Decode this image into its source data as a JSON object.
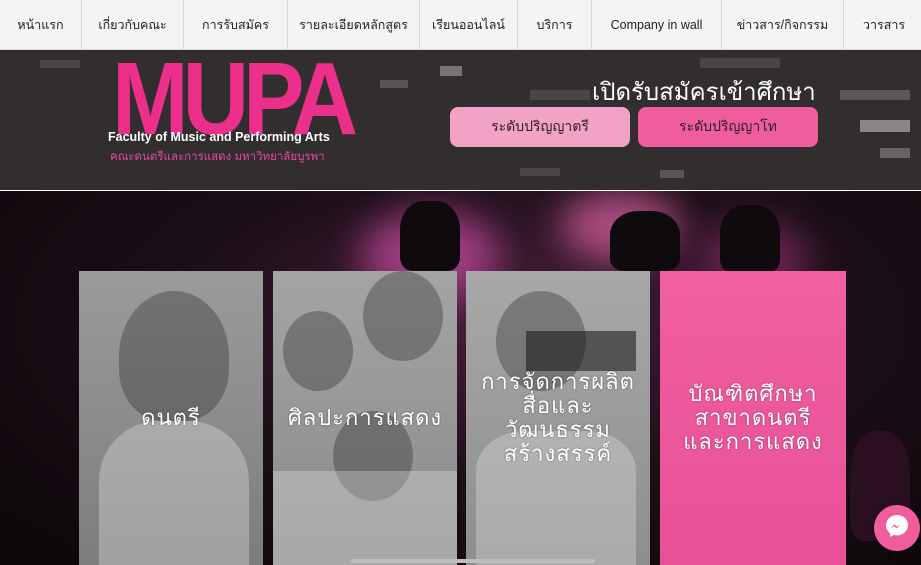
{
  "nav": {
    "items": [
      {
        "label": "หน้าแรก"
      },
      {
        "label": "เกี่ยวกับคณะ"
      },
      {
        "label": "การรับสมัคร"
      },
      {
        "label": "รายละเอียดหลักสูตร"
      },
      {
        "label": "เรียนออนไลน์"
      },
      {
        "label": "บริการ"
      },
      {
        "label": "Company in wall"
      },
      {
        "label": "ข่าวสาร/กิจกรรม"
      },
      {
        "label": "วารสาร"
      }
    ]
  },
  "header": {
    "logo_word": "MUPA",
    "logo_en": "Faculty of Music and Performing Arts",
    "logo_th": "คณะดนตรีและการแสดง มหาวิทยาลัยบูรพา",
    "open_title": "เปิดรับสมัครเข้าศึกษา",
    "bachelor_button": "ระดับปริญญาตรี",
    "master_button": "ระดับปริญญาโท"
  },
  "cards": [
    {
      "label": "ดนตรี"
    },
    {
      "label": "ศิลปะการแสดง"
    },
    {
      "label": "การจัดการผลิต\nสื่อและ\nวัฒนธรรม\nสร้างสรรค์"
    },
    {
      "label": "บัณฑิตศึกษา\nสาขาดนตรี\nและการแสดง"
    }
  ],
  "colors": {
    "brand_pink": "#ec2f8b",
    "button_light": "#f2a2c4",
    "button_strong": "#ef5d9d",
    "header_bg": "#322e30"
  },
  "icons": {
    "chat": "messenger-icon"
  }
}
